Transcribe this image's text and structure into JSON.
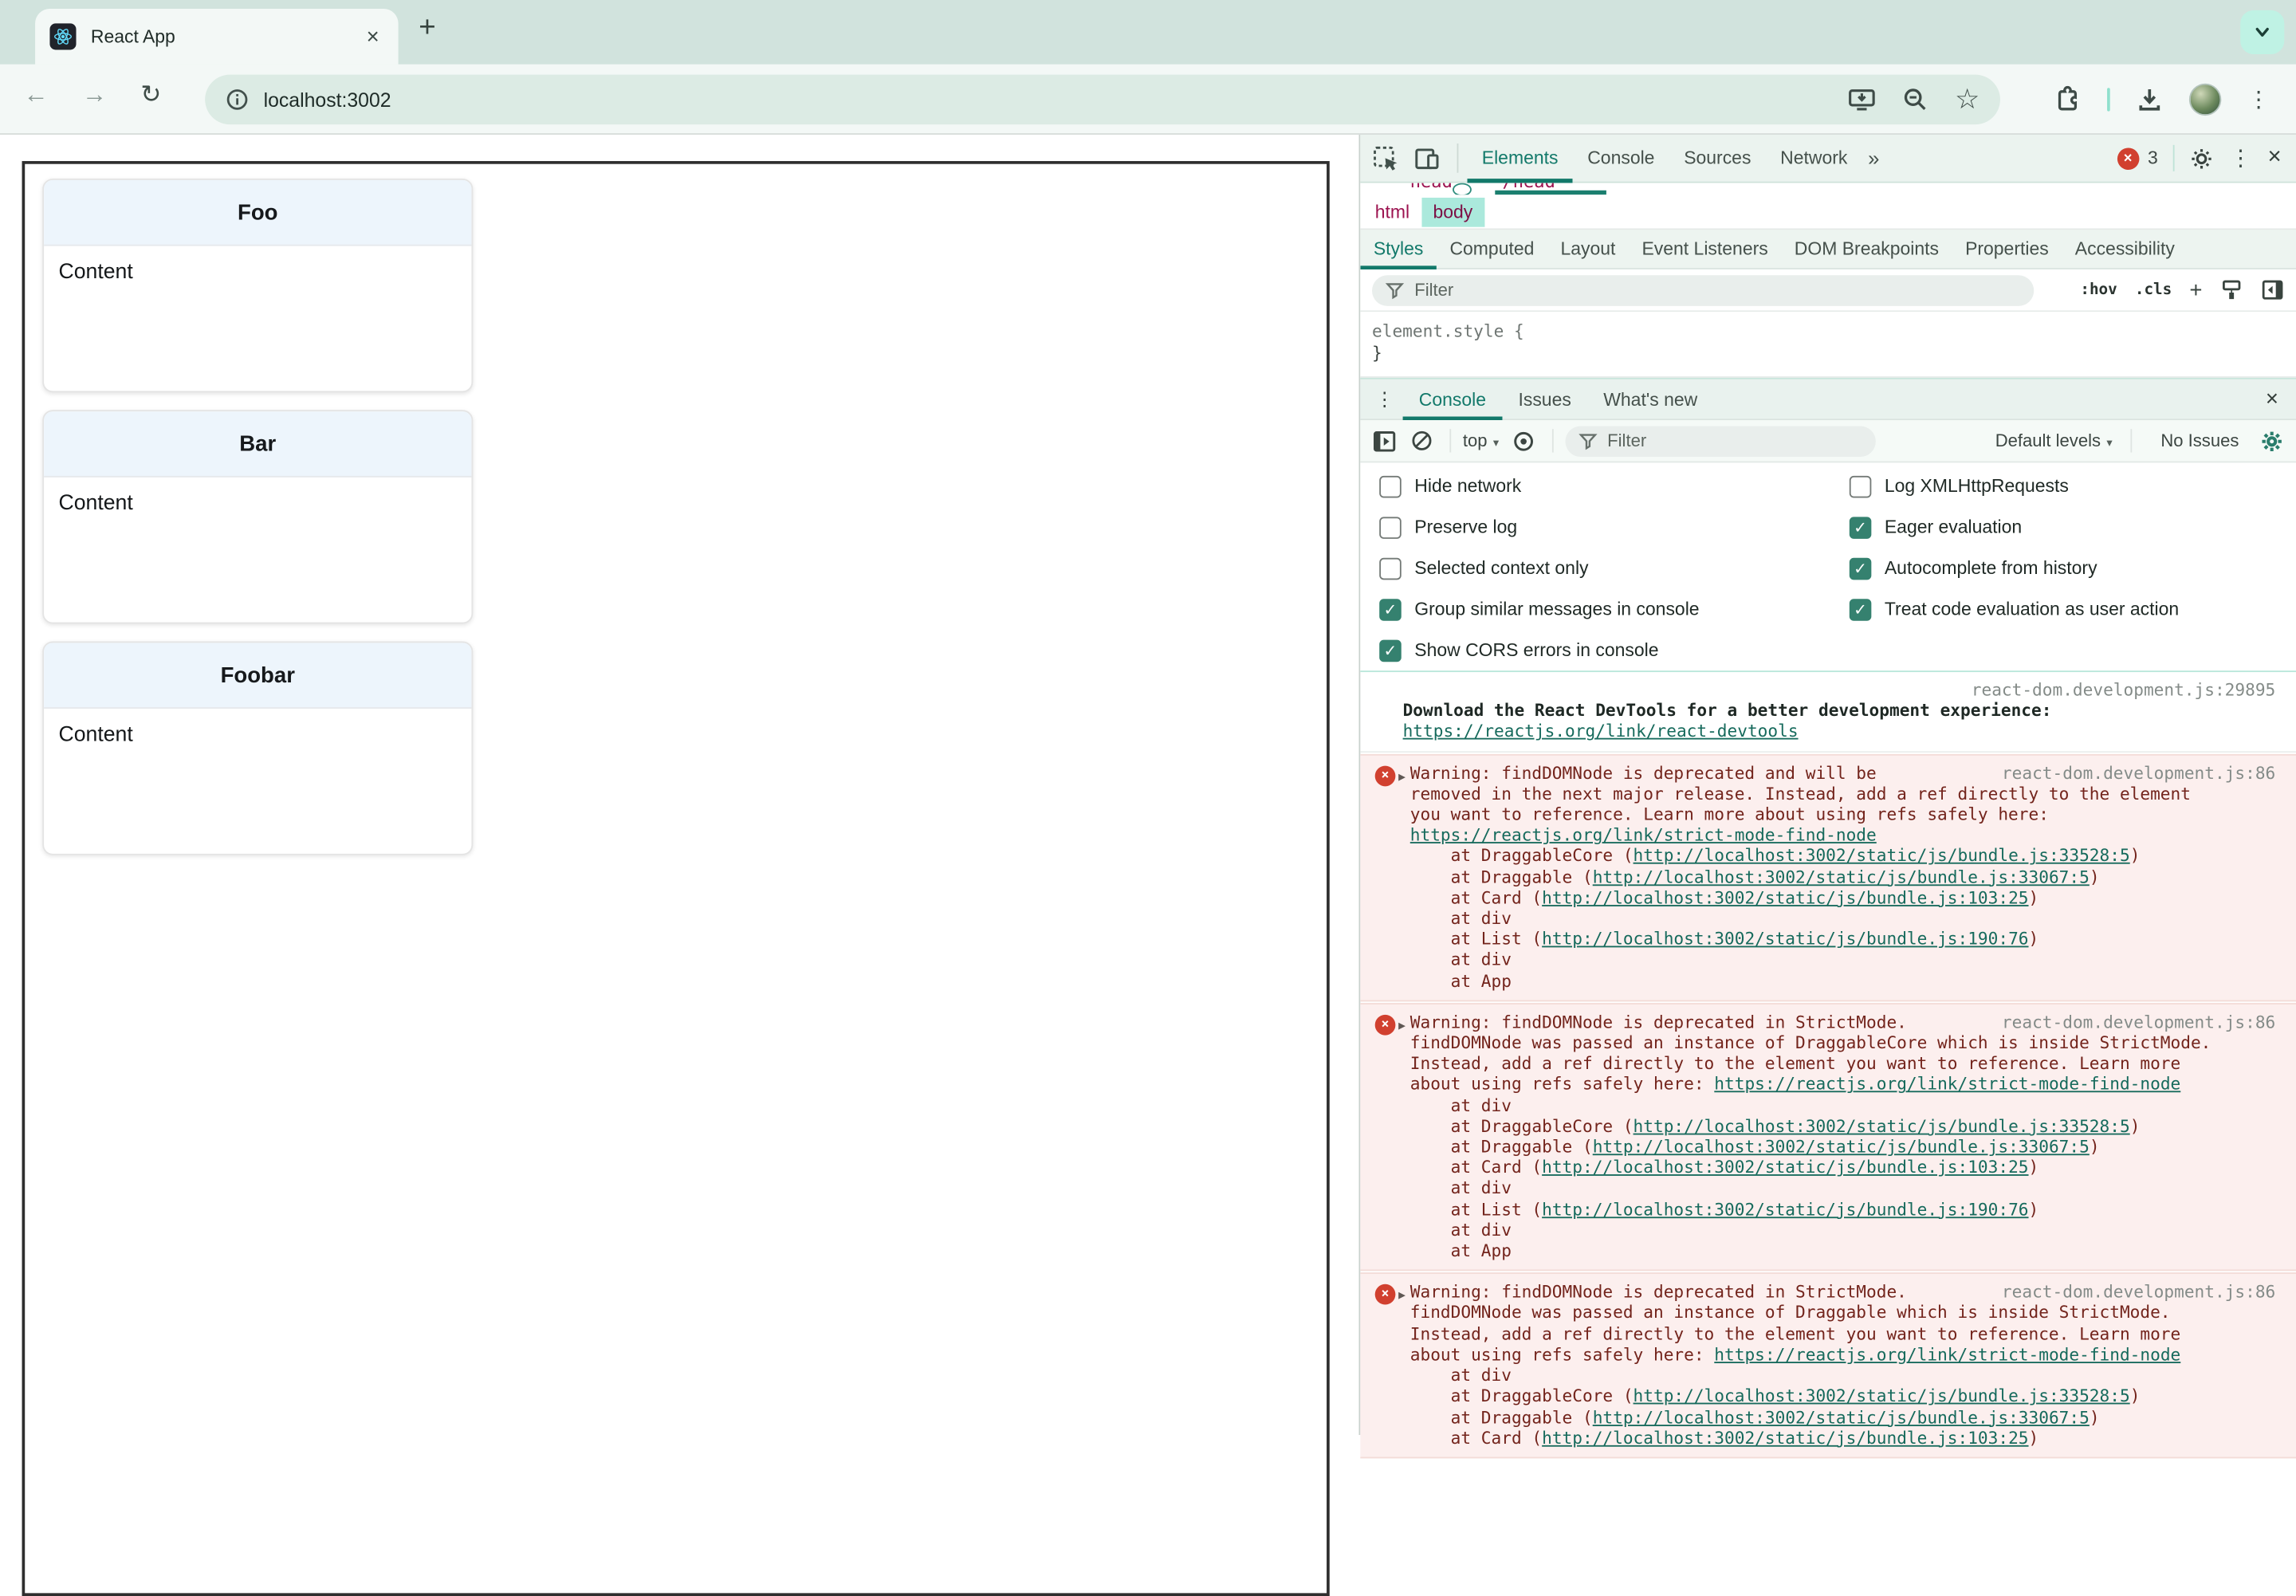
{
  "colors": {
    "accent_teal": "#12796a",
    "error_red": "#d1402f",
    "error_bg": "#fcefee",
    "error_text": "#73241c",
    "link": "#166a5c",
    "tab_strip": "#d1e3dd",
    "toolbar": "#f3f8f6",
    "url_pill": "#dcebe4",
    "highlight_chip": "#abe9dc",
    "checkbox": "#35816f",
    "badge_mint": "#bff2e4"
  },
  "icons": {
    "back": "←",
    "forward": "→",
    "reload": "↻",
    "star": "☆",
    "kebab": "⋮",
    "close": "×",
    "more_tabs": "»",
    "new_tab": "+",
    "expand": "▶",
    "caret": "▾",
    "badge_x": "×",
    "plus": "+",
    "check": "✓"
  },
  "browser": {
    "tab_title": "React App",
    "url": "localhost:3002"
  },
  "page": {
    "cards": [
      {
        "title": "Foo",
        "body": "Content"
      },
      {
        "title": "Bar",
        "body": "Content"
      },
      {
        "title": "Foobar",
        "body": "Content"
      }
    ]
  },
  "devtools": {
    "main_tabs": [
      {
        "label": "Elements",
        "selected": true
      },
      {
        "label": "Console",
        "selected": false
      },
      {
        "label": "Sources",
        "selected": false
      },
      {
        "label": "Network",
        "selected": false
      }
    ],
    "error_count": "3",
    "dom": {
      "fragments": [
        "head",
        "/head"
      ],
      "breadcrumbs": [
        {
          "label": "html",
          "selected": false
        },
        {
          "label": "body",
          "selected": true
        }
      ]
    },
    "styles_panel": {
      "tabs": [
        {
          "label": "Styles",
          "selected": true
        },
        {
          "label": "Computed",
          "selected": false
        },
        {
          "label": "Layout",
          "selected": false
        },
        {
          "label": "Event Listeners",
          "selected": false
        },
        {
          "label": "DOM Breakpoints",
          "selected": false
        },
        {
          "label": "Properties",
          "selected": false
        },
        {
          "label": "Accessibility",
          "selected": false
        }
      ],
      "filter_placeholder": "Filter",
      "hov": ":hov",
      "cls": ".cls",
      "element_style_open": "element.style {",
      "element_style_close": "}"
    },
    "drawer": {
      "tabs": [
        {
          "label": "Console",
          "selected": true
        },
        {
          "label": "Issues",
          "selected": false
        },
        {
          "label": "What's new",
          "selected": false
        }
      ]
    },
    "console_toolbar": {
      "context": "top",
      "filter_placeholder": "Filter",
      "levels": "Default levels",
      "issues": "No Issues"
    },
    "settings": {
      "left": [
        {
          "label": "Hide network",
          "checked": false
        },
        {
          "label": "Preserve log",
          "checked": false
        },
        {
          "label": "Selected context only",
          "checked": false
        },
        {
          "label": "Group similar messages in console",
          "checked": true
        },
        {
          "label": "Show CORS errors in console",
          "checked": true
        }
      ],
      "right": [
        {
          "label": "Log XMLHttpRequests",
          "checked": false
        },
        {
          "label": "Eager evaluation",
          "checked": true
        },
        {
          "label": "Autocomplete from history",
          "checked": true
        },
        {
          "label": "Treat code evaluation as user action",
          "checked": true
        }
      ]
    },
    "messages": [
      {
        "type": "log",
        "source": "react-dom.development.js:29895",
        "src_block": true,
        "lines": [
          [
            {
              "s": "bold",
              "t": "Download the React DevTools for a better development experience:"
            }
          ],
          [
            {
              "s": "link",
              "t": "https://reactjs.org/link/react-devtools"
            }
          ]
        ]
      },
      {
        "type": "error",
        "source": "react-dom.development.js:86",
        "src_block": false,
        "lines": [
          [
            {
              "t": "Warning: findDOMNode is deprecated and will be"
            }
          ],
          [
            {
              "t": "removed in the next major release. Instead, add a ref directly to the element"
            }
          ],
          [
            {
              "t": "you want to reference. Learn more about using refs safely here:"
            }
          ],
          [
            {
              "s": "link",
              "t": "https://reactjs.org/link/strict-mode-find-node"
            }
          ],
          [
            {
              "t": "    at DraggableCore ("
            },
            {
              "s": "link",
              "t": "http://localhost:3002/static/js/bundle.js:33528:5"
            },
            {
              "t": ")"
            }
          ],
          [
            {
              "t": "    at Draggable ("
            },
            {
              "s": "link",
              "t": "http://localhost:3002/static/js/bundle.js:33067:5"
            },
            {
              "t": ")"
            }
          ],
          [
            {
              "t": "    at Card ("
            },
            {
              "s": "link",
              "t": "http://localhost:3002/static/js/bundle.js:103:25"
            },
            {
              "t": ")"
            }
          ],
          [
            {
              "t": "    at div"
            }
          ],
          [
            {
              "t": "    at List ("
            },
            {
              "s": "link",
              "t": "http://localhost:3002/static/js/bundle.js:190:76"
            },
            {
              "t": ")"
            }
          ],
          [
            {
              "t": "    at div"
            }
          ],
          [
            {
              "t": "    at App"
            }
          ]
        ]
      },
      {
        "type": "error",
        "source": "react-dom.development.js:86",
        "src_block": false,
        "lines": [
          [
            {
              "t": "Warning: findDOMNode is deprecated in StrictMode."
            }
          ],
          [
            {
              "t": "findDOMNode was passed an instance of DraggableCore which is inside StrictMode."
            }
          ],
          [
            {
              "t": "Instead, add a ref directly to the element you want to reference. Learn more"
            }
          ],
          [
            {
              "t": "about using refs safely here: "
            },
            {
              "s": "link",
              "t": "https://reactjs.org/link/strict-mode-find-node"
            }
          ],
          [
            {
              "t": "    at div"
            }
          ],
          [
            {
              "t": "    at DraggableCore ("
            },
            {
              "s": "link",
              "t": "http://localhost:3002/static/js/bundle.js:33528:5"
            },
            {
              "t": ")"
            }
          ],
          [
            {
              "t": "    at Draggable ("
            },
            {
              "s": "link",
              "t": "http://localhost:3002/static/js/bundle.js:33067:5"
            },
            {
              "t": ")"
            }
          ],
          [
            {
              "t": "    at Card ("
            },
            {
              "s": "link",
              "t": "http://localhost:3002/static/js/bundle.js:103:25"
            },
            {
              "t": ")"
            }
          ],
          [
            {
              "t": "    at div"
            }
          ],
          [
            {
              "t": "    at List ("
            },
            {
              "s": "link",
              "t": "http://localhost:3002/static/js/bundle.js:190:76"
            },
            {
              "t": ")"
            }
          ],
          [
            {
              "t": "    at div"
            }
          ],
          [
            {
              "t": "    at App"
            }
          ]
        ]
      },
      {
        "type": "error",
        "source": "react-dom.development.js:86",
        "src_block": false,
        "lines": [
          [
            {
              "t": "Warning: findDOMNode is deprecated in StrictMode."
            }
          ],
          [
            {
              "t": "findDOMNode was passed an instance of Draggable which is inside StrictMode."
            }
          ],
          [
            {
              "t": "Instead, add a ref directly to the element you want to reference. Learn more"
            }
          ],
          [
            {
              "t": "about using refs safely here: "
            },
            {
              "s": "link",
              "t": "https://reactjs.org/link/strict-mode-find-node"
            }
          ],
          [
            {
              "t": "    at div"
            }
          ],
          [
            {
              "t": "    at DraggableCore ("
            },
            {
              "s": "link",
              "t": "http://localhost:3002/static/js/bundle.js:33528:5"
            },
            {
              "t": ")"
            }
          ],
          [
            {
              "t": "    at Draggable ("
            },
            {
              "s": "link",
              "t": "http://localhost:3002/static/js/bundle.js:33067:5"
            },
            {
              "t": ")"
            }
          ],
          [
            {
              "t": "    at Card ("
            },
            {
              "s": "link",
              "t": "http://localhost:3002/static/js/bundle.js:103:25"
            },
            {
              "t": ")"
            }
          ]
        ]
      }
    ]
  }
}
